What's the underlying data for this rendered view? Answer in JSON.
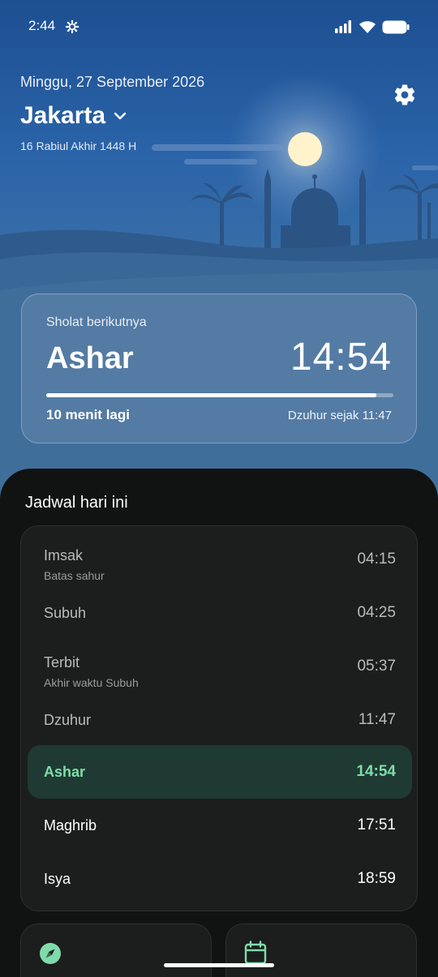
{
  "status_bar": {
    "time": "2:44"
  },
  "header": {
    "date": "Minggu, 27 September 2026",
    "city": "Jakarta",
    "hijri_date": "16 Rabiul Akhir 1448 H"
  },
  "next_prayer": {
    "label": "Sholat berikutnya",
    "name": "Ashar",
    "time": "14:54",
    "remaining": "10 menit lagi",
    "since": "Dzuhur sejak 11:47",
    "progress_fraction": 0.95
  },
  "schedule": {
    "title": "Jadwal hari ini",
    "rows": [
      {
        "name": "Imsak",
        "sub": "Batas sahur",
        "time": "04:15",
        "state": "past"
      },
      {
        "name": "Subuh",
        "sub": "",
        "time": "04:25",
        "state": "past"
      },
      {
        "name": "Terbit",
        "sub": "Akhir waktu Subuh",
        "time": "05:37",
        "state": "past"
      },
      {
        "name": "Dzuhur",
        "sub": "",
        "time": "11:47",
        "state": "past"
      },
      {
        "name": "Ashar",
        "sub": "",
        "time": "14:54",
        "state": "active"
      },
      {
        "name": "Maghrib",
        "sub": "",
        "time": "17:51",
        "state": "future"
      },
      {
        "name": "Isya",
        "sub": "",
        "time": "18:59",
        "state": "future"
      }
    ]
  },
  "shortcuts": [
    {
      "icon": "compass-icon",
      "color": "#7fdcaa"
    },
    {
      "icon": "calendar-icon",
      "color": "#7fdcaa"
    }
  ],
  "colors": {
    "accent": "#7fdcaa",
    "active_row": "#1f3a32",
    "sky": "#2a63a8"
  }
}
